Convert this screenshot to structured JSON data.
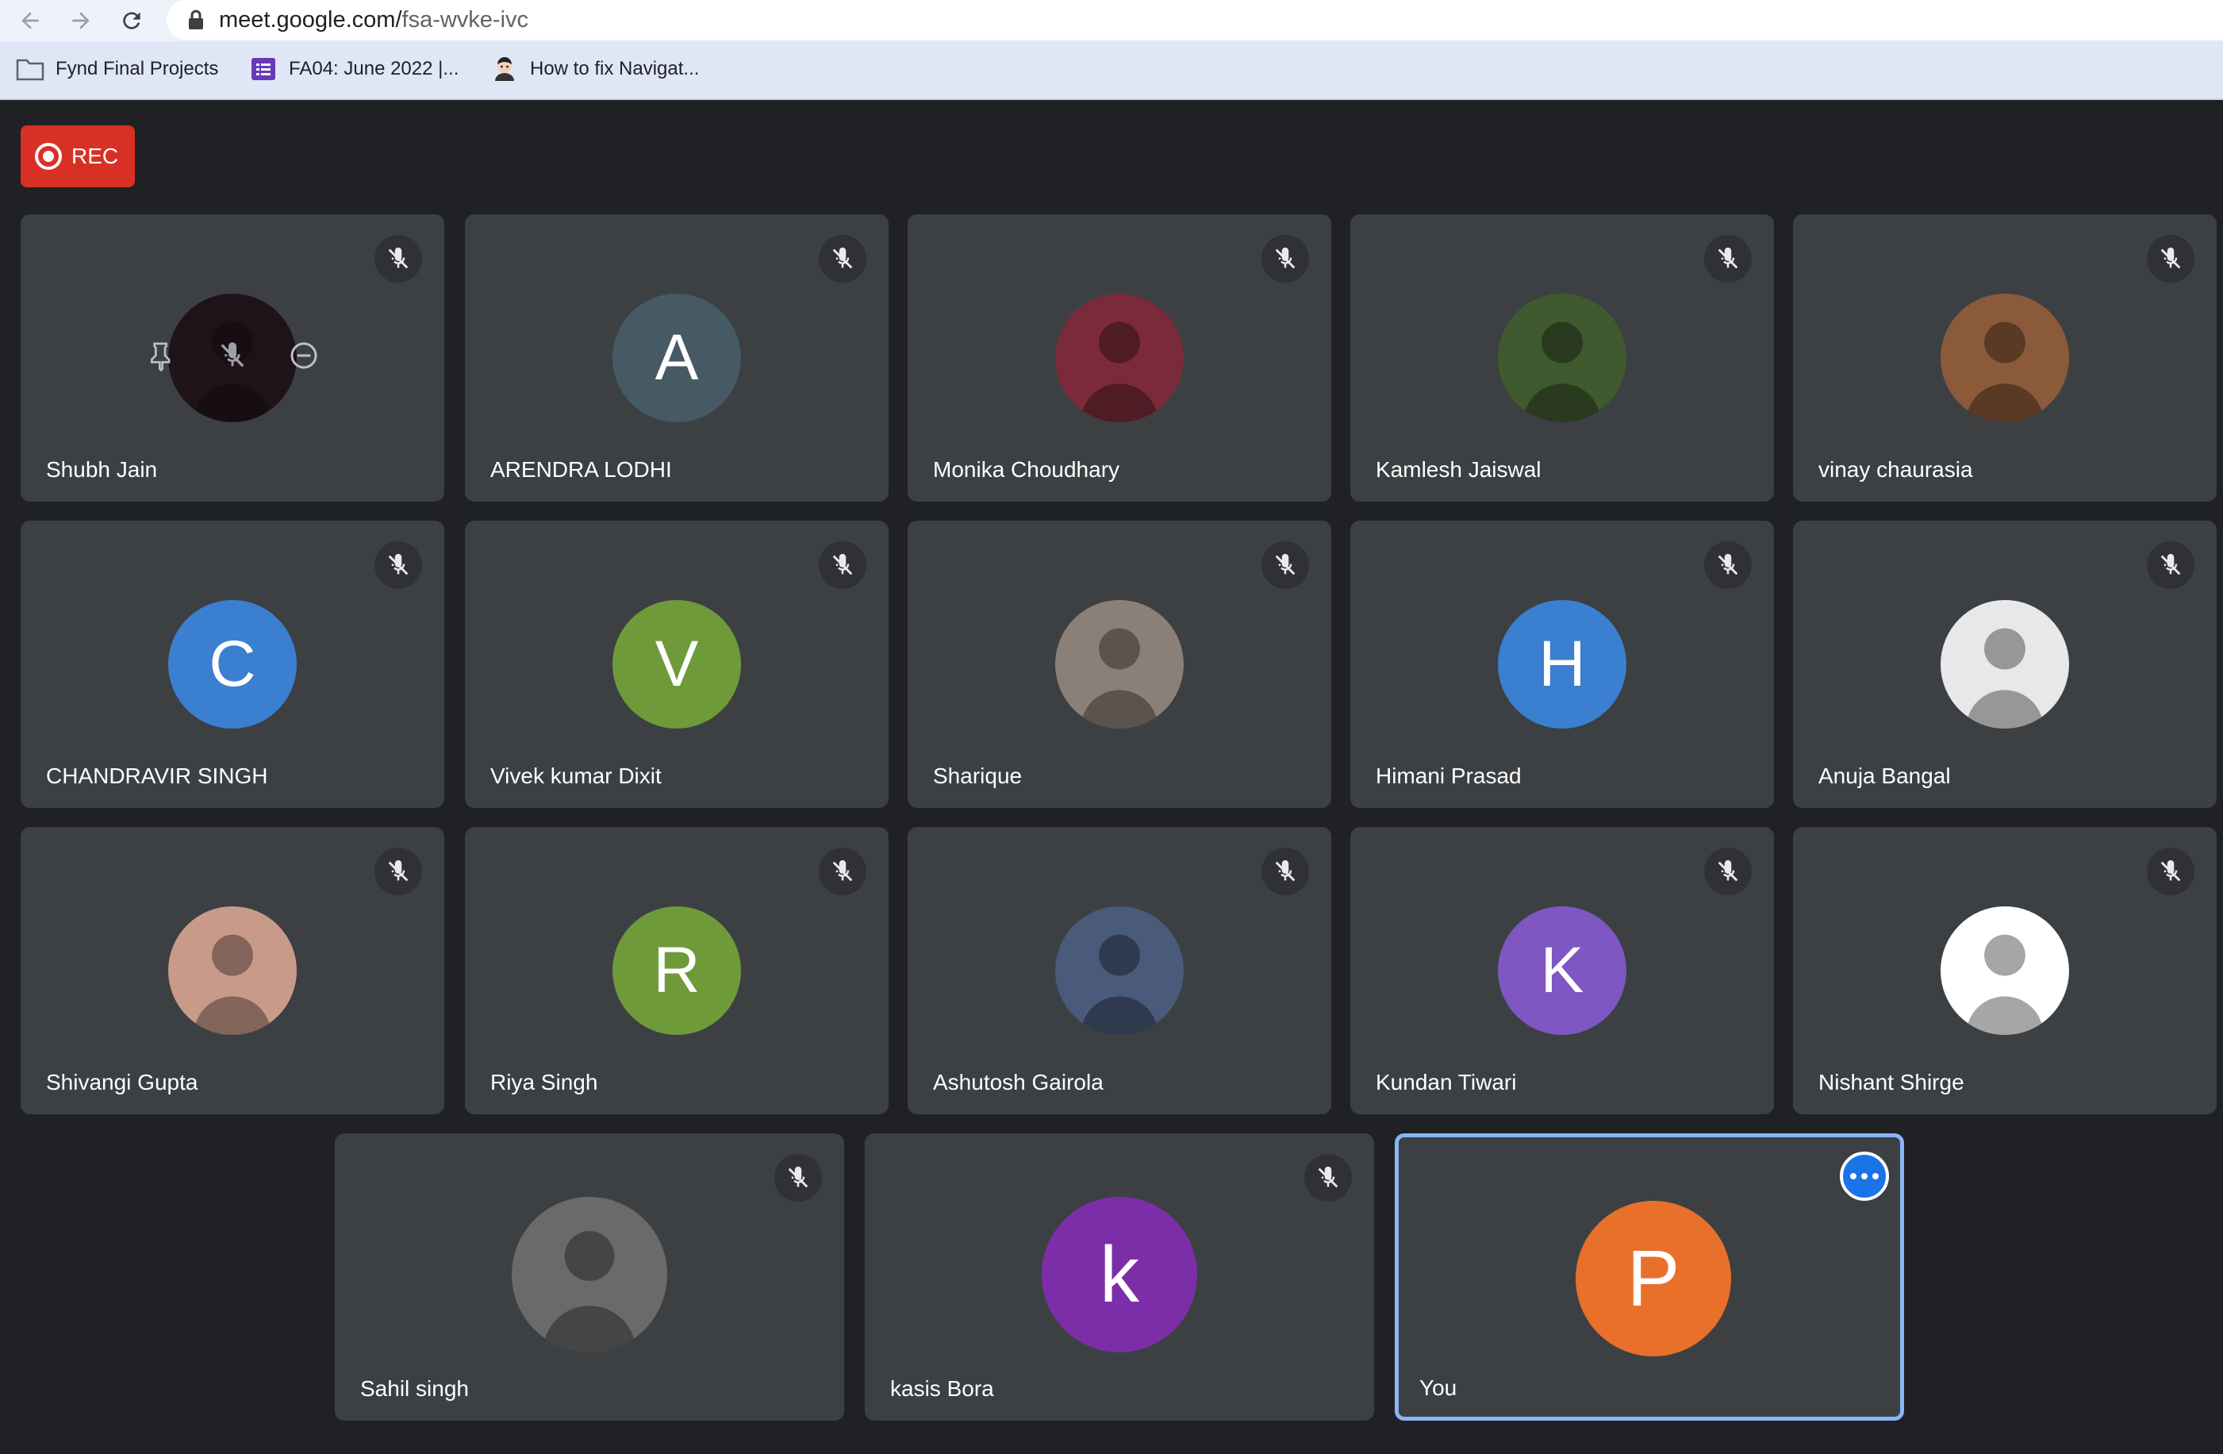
{
  "browser": {
    "url_host": "meet.google.com/",
    "url_path": "fsa-wvke-ivc",
    "bookmarks": [
      {
        "label": "Fynd Final Projects",
        "icon": "folder-icon"
      },
      {
        "label": "FA04: June 2022 |...",
        "icon": "forms-icon"
      },
      {
        "label": "How to fix Navigat...",
        "icon": "avatar-favicon"
      }
    ]
  },
  "recording": {
    "label": "REC"
  },
  "participants": [
    {
      "name": "Shubh Jain",
      "initial": "",
      "color": "#1b0a12",
      "avatar_type": "photo",
      "muted": true,
      "hovered": true
    },
    {
      "name": "ARENDRA LODHI",
      "initial": "A",
      "color": "#455a64",
      "avatar_type": "letter",
      "muted": true
    },
    {
      "name": "Monika Choudhary",
      "initial": "",
      "color": "#7a2a3a",
      "avatar_type": "photo",
      "muted": true
    },
    {
      "name": "Kamlesh Jaiswal",
      "initial": "",
      "color": "#3f5a2e",
      "avatar_type": "photo",
      "muted": true
    },
    {
      "name": "vinay chaurasia",
      "initial": "",
      "color": "#8a5a3a",
      "avatar_type": "photo",
      "muted": true
    },
    {
      "name": "CHANDRAVIR SINGH",
      "initial": "C",
      "color": "#3a7fd0",
      "avatar_type": "letter",
      "muted": true
    },
    {
      "name": "Vivek kumar Dixit",
      "initial": "V",
      "color": "#6f9a3a",
      "avatar_type": "letter",
      "muted": true
    },
    {
      "name": "Sharique",
      "initial": "",
      "color": "#8a8078",
      "avatar_type": "photo",
      "muted": true
    },
    {
      "name": "Himani Prasad",
      "initial": "H",
      "color": "#3a7fd0",
      "avatar_type": "letter",
      "muted": true
    },
    {
      "name": "Anuja Bangal",
      "initial": "",
      "color": "#e8e8ea",
      "avatar_type": "photo",
      "muted": true
    },
    {
      "name": "Shivangi Gupta",
      "initial": "",
      "color": "#c89a8a",
      "avatar_type": "photo",
      "muted": true
    },
    {
      "name": "Riya Singh",
      "initial": "R",
      "color": "#6f9a3a",
      "avatar_type": "letter",
      "muted": true
    },
    {
      "name": "Ashutosh Gairola",
      "initial": "",
      "color": "#4a5a7a",
      "avatar_type": "photo",
      "muted": true
    },
    {
      "name": "Kundan Tiwari",
      "initial": "K",
      "color": "#7e57c2",
      "avatar_type": "letter",
      "muted": true
    },
    {
      "name": "Nishant Shirge",
      "initial": "",
      "color": "#ffffff",
      "avatar_type": "photo",
      "muted": true
    },
    {
      "name": "Sahil singh",
      "initial": "",
      "color": "#6a6a6a",
      "avatar_type": "photo",
      "muted": true
    },
    {
      "name": "kasis Bora",
      "initial": "k",
      "color": "#7b2ea8",
      "avatar_type": "letter",
      "muted": true
    },
    {
      "name": "You",
      "initial": "P",
      "color": "#e8702a",
      "avatar_type": "letter",
      "muted": false,
      "self": true
    }
  ]
}
